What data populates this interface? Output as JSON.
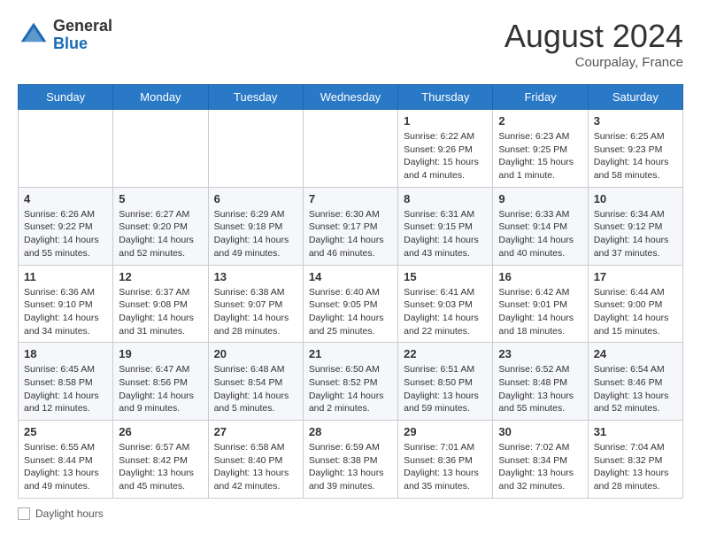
{
  "header": {
    "logo_general": "General",
    "logo_blue": "Blue",
    "month_year": "August 2024",
    "location": "Courpalay, France"
  },
  "weekdays": [
    "Sunday",
    "Monday",
    "Tuesday",
    "Wednesday",
    "Thursday",
    "Friday",
    "Saturday"
  ],
  "weeks": [
    [
      {
        "day": "",
        "info": ""
      },
      {
        "day": "",
        "info": ""
      },
      {
        "day": "",
        "info": ""
      },
      {
        "day": "",
        "info": ""
      },
      {
        "day": "1",
        "info": "Sunrise: 6:22 AM\nSunset: 9:26 PM\nDaylight: 15 hours\nand 4 minutes."
      },
      {
        "day": "2",
        "info": "Sunrise: 6:23 AM\nSunset: 9:25 PM\nDaylight: 15 hours\nand 1 minute."
      },
      {
        "day": "3",
        "info": "Sunrise: 6:25 AM\nSunset: 9:23 PM\nDaylight: 14 hours\nand 58 minutes."
      }
    ],
    [
      {
        "day": "4",
        "info": "Sunrise: 6:26 AM\nSunset: 9:22 PM\nDaylight: 14 hours\nand 55 minutes."
      },
      {
        "day": "5",
        "info": "Sunrise: 6:27 AM\nSunset: 9:20 PM\nDaylight: 14 hours\nand 52 minutes."
      },
      {
        "day": "6",
        "info": "Sunrise: 6:29 AM\nSunset: 9:18 PM\nDaylight: 14 hours\nand 49 minutes."
      },
      {
        "day": "7",
        "info": "Sunrise: 6:30 AM\nSunset: 9:17 PM\nDaylight: 14 hours\nand 46 minutes."
      },
      {
        "day": "8",
        "info": "Sunrise: 6:31 AM\nSunset: 9:15 PM\nDaylight: 14 hours\nand 43 minutes."
      },
      {
        "day": "9",
        "info": "Sunrise: 6:33 AM\nSunset: 9:14 PM\nDaylight: 14 hours\nand 40 minutes."
      },
      {
        "day": "10",
        "info": "Sunrise: 6:34 AM\nSunset: 9:12 PM\nDaylight: 14 hours\nand 37 minutes."
      }
    ],
    [
      {
        "day": "11",
        "info": "Sunrise: 6:36 AM\nSunset: 9:10 PM\nDaylight: 14 hours\nand 34 minutes."
      },
      {
        "day": "12",
        "info": "Sunrise: 6:37 AM\nSunset: 9:08 PM\nDaylight: 14 hours\nand 31 minutes."
      },
      {
        "day": "13",
        "info": "Sunrise: 6:38 AM\nSunset: 9:07 PM\nDaylight: 14 hours\nand 28 minutes."
      },
      {
        "day": "14",
        "info": "Sunrise: 6:40 AM\nSunset: 9:05 PM\nDaylight: 14 hours\nand 25 minutes."
      },
      {
        "day": "15",
        "info": "Sunrise: 6:41 AM\nSunset: 9:03 PM\nDaylight: 14 hours\nand 22 minutes."
      },
      {
        "day": "16",
        "info": "Sunrise: 6:42 AM\nSunset: 9:01 PM\nDaylight: 14 hours\nand 18 minutes."
      },
      {
        "day": "17",
        "info": "Sunrise: 6:44 AM\nSunset: 9:00 PM\nDaylight: 14 hours\nand 15 minutes."
      }
    ],
    [
      {
        "day": "18",
        "info": "Sunrise: 6:45 AM\nSunset: 8:58 PM\nDaylight: 14 hours\nand 12 minutes."
      },
      {
        "day": "19",
        "info": "Sunrise: 6:47 AM\nSunset: 8:56 PM\nDaylight: 14 hours\nand 9 minutes."
      },
      {
        "day": "20",
        "info": "Sunrise: 6:48 AM\nSunset: 8:54 PM\nDaylight: 14 hours\nand 5 minutes."
      },
      {
        "day": "21",
        "info": "Sunrise: 6:50 AM\nSunset: 8:52 PM\nDaylight: 14 hours\nand 2 minutes."
      },
      {
        "day": "22",
        "info": "Sunrise: 6:51 AM\nSunset: 8:50 PM\nDaylight: 13 hours\nand 59 minutes."
      },
      {
        "day": "23",
        "info": "Sunrise: 6:52 AM\nSunset: 8:48 PM\nDaylight: 13 hours\nand 55 minutes."
      },
      {
        "day": "24",
        "info": "Sunrise: 6:54 AM\nSunset: 8:46 PM\nDaylight: 13 hours\nand 52 minutes."
      }
    ],
    [
      {
        "day": "25",
        "info": "Sunrise: 6:55 AM\nSunset: 8:44 PM\nDaylight: 13 hours\nand 49 minutes."
      },
      {
        "day": "26",
        "info": "Sunrise: 6:57 AM\nSunset: 8:42 PM\nDaylight: 13 hours\nand 45 minutes."
      },
      {
        "day": "27",
        "info": "Sunrise: 6:58 AM\nSunset: 8:40 PM\nDaylight: 13 hours\nand 42 minutes."
      },
      {
        "day": "28",
        "info": "Sunrise: 6:59 AM\nSunset: 8:38 PM\nDaylight: 13 hours\nand 39 minutes."
      },
      {
        "day": "29",
        "info": "Sunrise: 7:01 AM\nSunset: 8:36 PM\nDaylight: 13 hours\nand 35 minutes."
      },
      {
        "day": "30",
        "info": "Sunrise: 7:02 AM\nSunset: 8:34 PM\nDaylight: 13 hours\nand 32 minutes."
      },
      {
        "day": "31",
        "info": "Sunrise: 7:04 AM\nSunset: 8:32 PM\nDaylight: 13 hours\nand 28 minutes."
      }
    ]
  ],
  "footer": {
    "label": "Daylight hours"
  }
}
